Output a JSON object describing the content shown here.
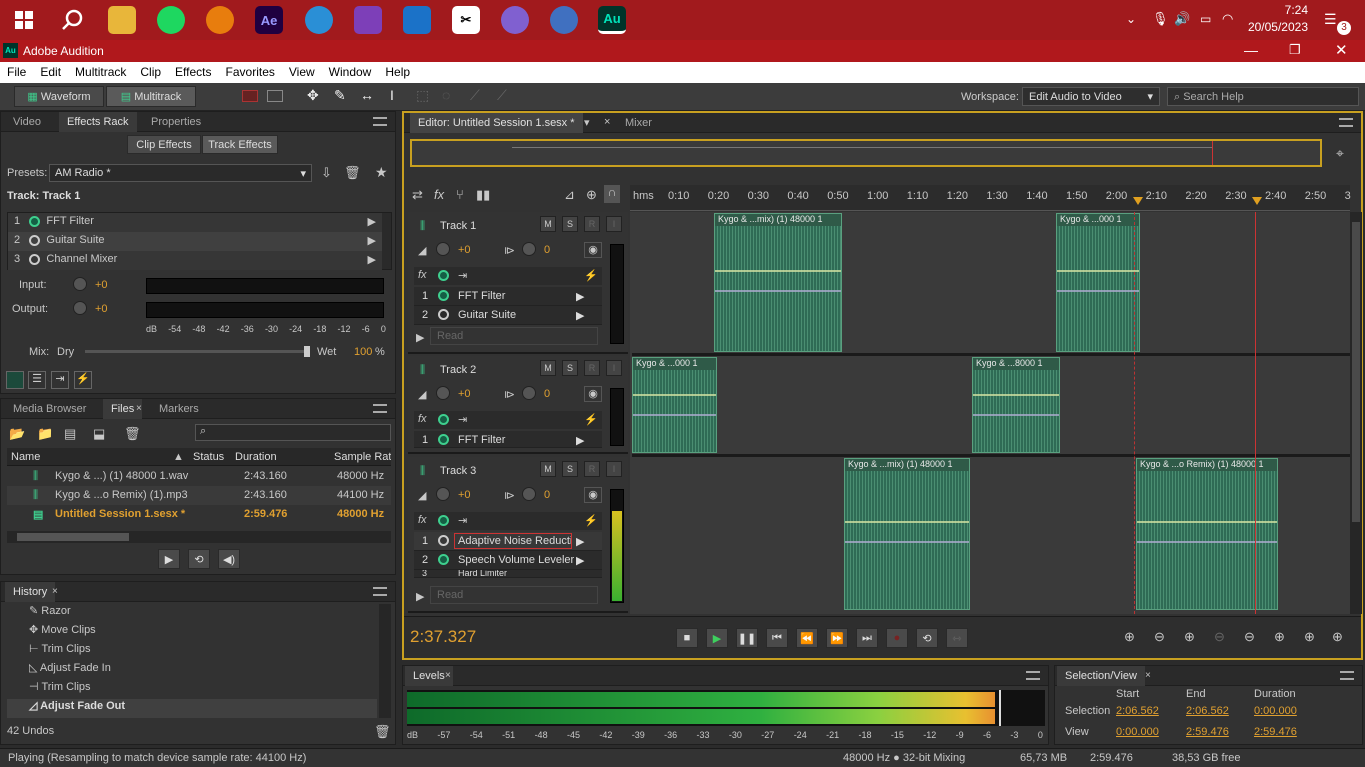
{
  "taskbar": {
    "time": "7:24",
    "date": "20/05/2023",
    "notif_count": "3"
  },
  "window": {
    "title": "Adobe Audition",
    "app_badge": "Au"
  },
  "menu": [
    "File",
    "Edit",
    "Multitrack",
    "Clip",
    "Effects",
    "Favorites",
    "View",
    "Window",
    "Help"
  ],
  "toolbar": {
    "waveform": "Waveform",
    "multitrack": "Multitrack",
    "workspace_label": "Workspace:",
    "workspace_value": "Edit Audio to Video",
    "search_placeholder": "Search Help"
  },
  "left_tabs": {
    "video": "Video",
    "effects_rack": "Effects Rack",
    "properties": "Properties"
  },
  "rack": {
    "clip_effects": "Clip Effects",
    "track_effects": "Track Effects",
    "presets_label": "Presets:",
    "preset": "AM Radio *",
    "track": "Track: Track 1",
    "effects": [
      {
        "n": "1",
        "name": "FFT Filter"
      },
      {
        "n": "2",
        "name": "Guitar Suite"
      },
      {
        "n": "3",
        "name": "Channel Mixer"
      }
    ],
    "input_label": "Input:",
    "output_label": "Output:",
    "input_val": "+0",
    "output_val": "+0",
    "scale": [
      "dB",
      "-54",
      "-48",
      "-42",
      "-36",
      "-30",
      "-24",
      "-18",
      "-12",
      "-6",
      "0"
    ],
    "mix_label": "Mix:",
    "dry": "Dry",
    "wet": "Wet",
    "wet_val": "100",
    "pct": "%"
  },
  "files_tabs": {
    "media": "Media Browser",
    "files": "Files",
    "markers": "Markers"
  },
  "files": {
    "cols": [
      "Name",
      "Status",
      "Duration",
      "Sample Rate"
    ],
    "rows": [
      {
        "name": "Kygo & ...) (1) 48000 1.wav",
        "dur": "2:43.160",
        "rate": "48000 Hz"
      },
      {
        "name": "Kygo & ...o Remix) (1).mp3",
        "dur": "2:43.160",
        "rate": "44100 Hz"
      },
      {
        "name": "Untitled Session 1.sesx *",
        "dur": "2:59.476",
        "rate": "48000 Hz"
      }
    ]
  },
  "history": {
    "tab": "History",
    "items": [
      "Razor",
      "Move Clips",
      "Trim Clips",
      "Adjust Fade In",
      "Trim Clips",
      "Adjust Fade Out"
    ],
    "undos": "42 Undos"
  },
  "editor": {
    "tab": "Editor: Untitled Session 1.sesx *",
    "mixer": "Mixer",
    "time_unit": "hms",
    "ticks": [
      "0:10",
      "0:20",
      "0:30",
      "0:40",
      "0:50",
      "1:00",
      "1:10",
      "1:20",
      "1:30",
      "1:40",
      "1:50",
      "2:00",
      "2:10",
      "2:20",
      "2:30",
      "2:40",
      "2:50",
      "3"
    ],
    "current_time": "2:37.327"
  },
  "tracks": [
    {
      "name": "Track 1",
      "vol": "+0",
      "pan": "0",
      "read": "Read",
      "fx": [
        {
          "n": "1",
          "name": "FFT Filter"
        },
        {
          "n": "2",
          "name": "Guitar Suite"
        }
      ],
      "clips": [
        "Kygo & ...mix) (1) 48000 1",
        "Kygo & ...000 1"
      ]
    },
    {
      "name": "Track 2",
      "vol": "+0",
      "pan": "0",
      "fx": [
        {
          "n": "1",
          "name": "FFT Filter"
        }
      ],
      "clips": [
        "Kygo & ...000 1",
        "Kygo & ...8000 1"
      ]
    },
    {
      "name": "Track 3",
      "vol": "+0",
      "pan": "0",
      "read": "Read",
      "fx": [
        {
          "n": "1",
          "name": "Adaptive Noise Reducti"
        },
        {
          "n": "2",
          "name": "Speech Volume Leveler"
        },
        {
          "n": "3",
          "name": "Hard Limiter"
        }
      ],
      "clips": [
        "Kygo & ...mix) (1) 48000 1",
        "Kygo & ...o Remix) (1) 48000 1"
      ]
    }
  ],
  "msri": [
    "M",
    "S",
    "R",
    "I"
  ],
  "levels": {
    "tab": "Levels",
    "scale": [
      "dB",
      "-57",
      "-54",
      "-51",
      "-48",
      "-45",
      "-42",
      "-39",
      "-36",
      "-33",
      "-30",
      "-27",
      "-24",
      "-21",
      "-18",
      "-15",
      "-12",
      "-9",
      "-6",
      "-3",
      "0"
    ]
  },
  "selection": {
    "tab": "Selection/View",
    "start": "Start",
    "end": "End",
    "duration": "Duration",
    "sel_label": "Selection",
    "view_label": "View",
    "sel_start": "2:06.562",
    "sel_end": "2:06.562",
    "sel_dur": "0:00.000",
    "view_start": "0:00.000",
    "view_end": "2:59.476",
    "view_dur": "2:59.476"
  },
  "status": {
    "left": "Playing (Resampling to match device sample rate: 44100 Hz)",
    "format": "48000 Hz ● 32-bit Mixing",
    "mem": "65,73 MB",
    "dur": "2:59.476",
    "free": "38,53 GB free"
  }
}
